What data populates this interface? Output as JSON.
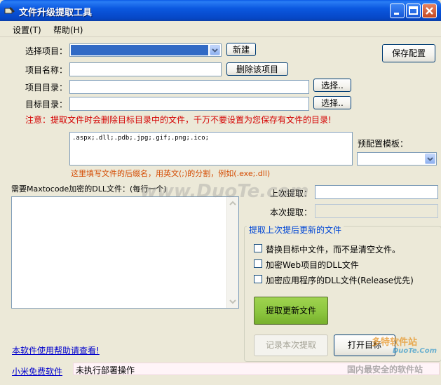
{
  "window": {
    "title": "文件升级提取工具"
  },
  "menu": {
    "settings": "设置(T)",
    "help": "帮助(H)"
  },
  "labels": {
    "select_project": "选择项目：",
    "project_name": "项目名称：",
    "project_dir": "项目目录：",
    "target_dir": "目标目录：",
    "preset_template": "预配置模板：",
    "dll_list": "需要Maxtocode加密的DLL文件：(每行一个)",
    "last_extract": "上次提取：",
    "this_extract": "本次提取："
  },
  "buttons": {
    "new": "新建",
    "delete_project": "删除该项目",
    "browse1": "选择..",
    "browse2": "选择..",
    "save_config": "保存配置",
    "extract_updates": "提取更新文件",
    "record_extract": "记录本次提取",
    "open_target": "打开目标"
  },
  "warning": "注意：提取文件时会删除目标目录中的文件，千万不要设置为您保存有文件的目录!",
  "extensions": {
    "value": ".aspx;.dll;.pdb;.jpg;.gif;.png;.ico;"
  },
  "ext_hint": "这里填写文件的后缀名，用英文(;)的分割，例如(.exe;.dll)",
  "group": {
    "title": "提取上次提后更新的文件",
    "options": [
      "替换目标中文件，而不是清空文件。",
      "加密Web项目的DLL文件",
      "加密应用程序的DLL文件(Release优先)"
    ]
  },
  "links": {
    "help": "本软件使用帮助请查看!",
    "free": "小米免费软件"
  },
  "status": "未执行部署操作",
  "watermarks": {
    "main": "www.DuoTe.com",
    "corner_brand": "多特软件站",
    "corner_site": "DuoTe.Com",
    "corner_slogan": "国内最安全的软件站"
  },
  "colors": {
    "title_bar": "#0b58e0",
    "primary_button": "#8cc63f",
    "warning": "#d40000",
    "link": "#0000cc"
  }
}
